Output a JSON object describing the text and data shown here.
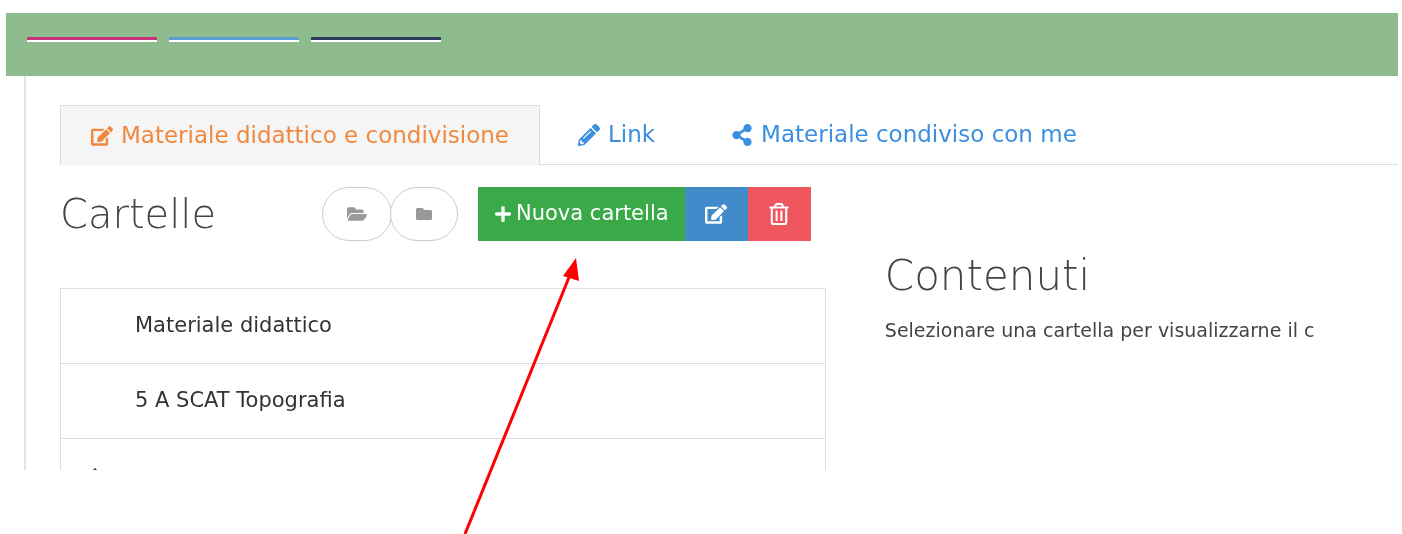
{
  "tabs": [
    {
      "label": "Materiale didattico e condivisione",
      "selected": true
    },
    {
      "label": "Link",
      "selected": false
    },
    {
      "label": "Materiale condiviso con me",
      "selected": false
    }
  ],
  "folders_panel": {
    "title": "Cartelle",
    "new_button": "Nuova cartella",
    "folders": [
      {
        "name": "Materiale didattico",
        "has_children": false
      },
      {
        "name": "5 A SCAT Topografia",
        "has_children": false
      },
      {
        "has_children": true
      }
    ]
  },
  "contents_panel": {
    "title": "Contenuti",
    "message": "Selezionare una cartella per visualizzarne il c"
  }
}
